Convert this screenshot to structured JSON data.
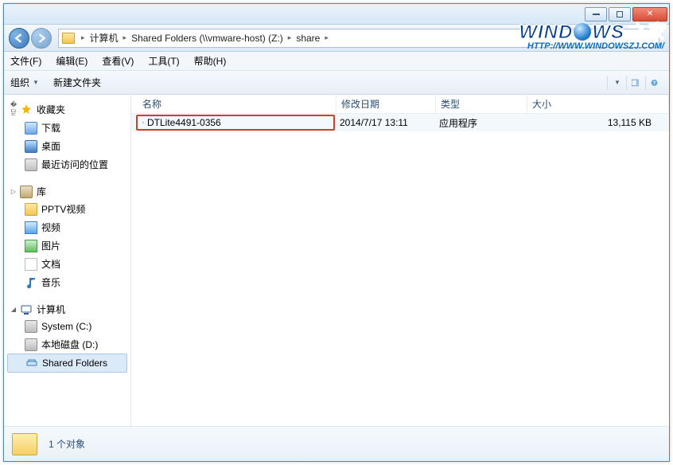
{
  "window_controls": {
    "min": "–",
    "max": "□",
    "close": "✕"
  },
  "breadcrumb": {
    "root": "计算机",
    "mid": "Shared Folders (\\\\vmware-host) (Z:)",
    "leaf": "share"
  },
  "watermark": {
    "brand_pre": "WIND",
    "brand_mid": "WS",
    "brand_suffix": "之家",
    "url": "HTTP://WWW.WINDOWSZJ.COM/"
  },
  "menus": {
    "file": "文件(F)",
    "edit": "编辑(E)",
    "view": "查看(V)",
    "tools": "工具(T)",
    "help": "帮助(H)"
  },
  "toolbar": {
    "organize": "组织",
    "new_folder": "新建文件夹"
  },
  "sidebar": {
    "favorites": {
      "label": "收藏夹",
      "items": [
        {
          "icon": "blue-dr",
          "label": "下载"
        },
        {
          "icon": "mon",
          "label": "桌面"
        },
        {
          "icon": "loc",
          "label": "最近访问的位置"
        }
      ]
    },
    "library": {
      "label": "库",
      "items": [
        {
          "icon": "folder",
          "label": "PPTV视频"
        },
        {
          "icon": "vid",
          "label": "视频"
        },
        {
          "icon": "pic",
          "label": "图片"
        },
        {
          "icon": "doc",
          "label": "文档"
        },
        {
          "icon": "mus",
          "label": "音乐"
        }
      ]
    },
    "computer": {
      "label": "计算机",
      "items": [
        {
          "icon": "drv",
          "label": "System (C:)"
        },
        {
          "icon": "drv",
          "label": "本地磁盘 (D:)"
        },
        {
          "icon": "net",
          "label": "Shared Folders",
          "selected": true
        }
      ]
    }
  },
  "columns": {
    "name": "名称",
    "date": "修改日期",
    "type": "类型",
    "size": "大小"
  },
  "files": [
    {
      "name": "DTLite4491-0356",
      "date": "2014/7/17 13:11",
      "type": "应用程序",
      "size": "13,115 KB",
      "highlight": true
    }
  ],
  "status": {
    "text": "1 个对象"
  }
}
